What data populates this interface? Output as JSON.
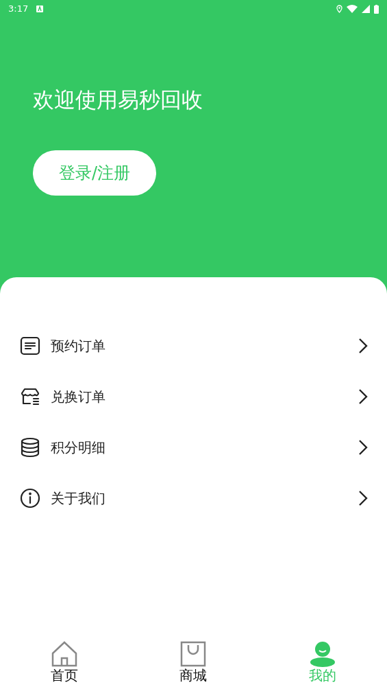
{
  "status_bar": {
    "time": "3:17"
  },
  "header": {
    "welcome": "欢迎使用易秒回收",
    "login_button": "登录/注册"
  },
  "menu": [
    {
      "kind": "order",
      "label": "预约订单"
    },
    {
      "kind": "store",
      "label": "兑换订单"
    },
    {
      "kind": "coins",
      "label": "积分明细"
    },
    {
      "kind": "info",
      "label": "关于我们"
    }
  ],
  "tab_bar": [
    {
      "kind": "home",
      "label": "首页",
      "selected": false
    },
    {
      "kind": "bag",
      "label": "商城",
      "selected": false
    },
    {
      "kind": "person",
      "label": "我的",
      "selected": true
    }
  ]
}
